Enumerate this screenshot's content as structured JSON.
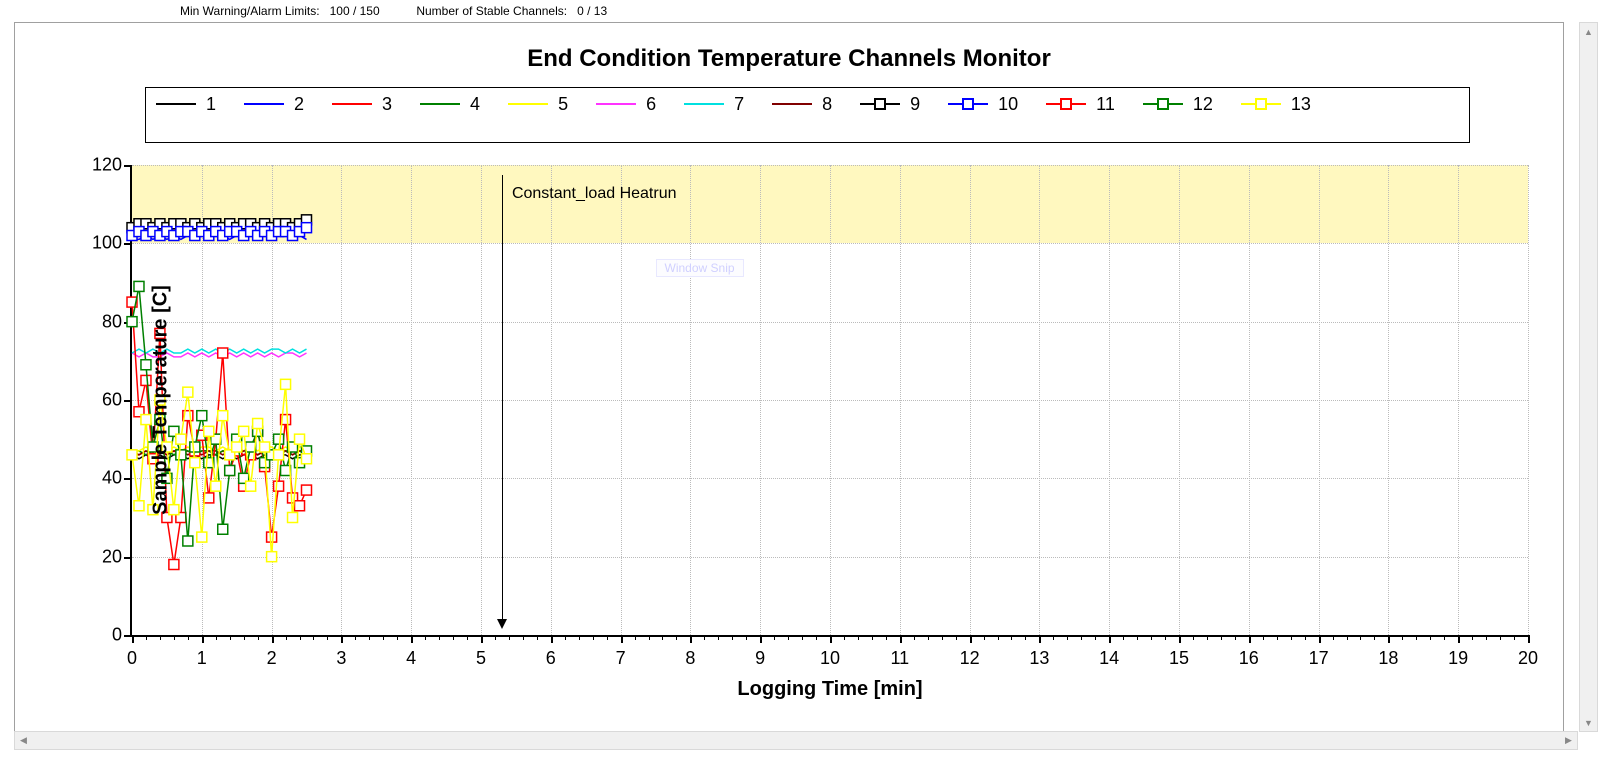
{
  "header": {
    "limits_label": "Min Warning/Alarm Limits:",
    "limits_value": "100 / 150",
    "stable_label": "Number of Stable Channels:",
    "stable_value": "0 / 13"
  },
  "chart_data": {
    "type": "line",
    "title": "End Condition Temperature Channels Monitor",
    "xlabel": "Logging Time [min]",
    "ylabel": "Sample Temperature [C]",
    "xlim": [
      0,
      20
    ],
    "ylim": [
      0,
      120
    ],
    "x_major_step": 1,
    "y_major_step": 20,
    "warning_band": {
      "low": 100,
      "high": 120,
      "low_label": "100",
      "high_label": "150"
    },
    "annotation": {
      "x": 5.3,
      "text": "Constant_load Heatrun"
    },
    "legend": [
      {
        "id": "1",
        "color": "#000000",
        "marker": false
      },
      {
        "id": "2",
        "color": "#0000ff",
        "marker": false
      },
      {
        "id": "3",
        "color": "#ff0000",
        "marker": false
      },
      {
        "id": "4",
        "color": "#008000",
        "marker": false
      },
      {
        "id": "5",
        "color": "#ffff00",
        "marker": false
      },
      {
        "id": "6",
        "color": "#ff33ff",
        "marker": false
      },
      {
        "id": "7",
        "color": "#00e0e0",
        "marker": false
      },
      {
        "id": "8",
        "color": "#800000",
        "marker": false
      },
      {
        "id": "9",
        "color": "#000000",
        "marker": true
      },
      {
        "id": "10",
        "color": "#0000ff",
        "marker": true
      },
      {
        "id": "11",
        "color": "#ff0000",
        "marker": true
      },
      {
        "id": "12",
        "color": "#008000",
        "marker": true
      },
      {
        "id": "13",
        "color": "#ffff00",
        "marker": true
      }
    ],
    "x": [
      0,
      0.1,
      0.2,
      0.3,
      0.4,
      0.5,
      0.6,
      0.7,
      0.8,
      0.9,
      1.0,
      1.1,
      1.2,
      1.3,
      1.4,
      1.5,
      1.6,
      1.7,
      1.8,
      1.9,
      2.0,
      2.1,
      2.2,
      2.3,
      2.4,
      2.5
    ],
    "series": [
      {
        "name": "1",
        "color": "#000000",
        "marker": false,
        "values": [
          46,
          45,
          46,
          45,
          46,
          45,
          46,
          46,
          45,
          46,
          45,
          46,
          46,
          45,
          46,
          45,
          46,
          46,
          45,
          46,
          45,
          46,
          46,
          45,
          46,
          46
        ]
      },
      {
        "name": "2",
        "color": "#0000ff",
        "marker": false,
        "values": [
          101,
          101,
          102,
          101,
          102,
          101,
          102,
          101,
          102,
          101,
          102,
          101,
          102,
          102,
          101,
          102,
          101,
          102,
          101,
          102,
          101,
          102,
          102,
          101,
          102,
          101
        ]
      },
      {
        "name": "3",
        "color": "#ff0000",
        "marker": false,
        "values": [
          46,
          46,
          47,
          46,
          47,
          46,
          47,
          46,
          47,
          46,
          47,
          47,
          46,
          47,
          46,
          47,
          46,
          47,
          46,
          47,
          47,
          46,
          47,
          46,
          47,
          47
        ]
      },
      {
        "name": "4",
        "color": "#008000",
        "marker": false,
        "values": [
          47,
          47,
          46,
          47,
          47,
          47,
          46,
          47,
          47,
          46,
          47,
          47,
          46,
          47,
          47,
          46,
          47,
          47,
          46,
          47,
          47,
          46,
          47,
          47,
          47,
          46
        ]
      },
      {
        "name": "5",
        "color": "#ffff00",
        "marker": false,
        "values": [
          47,
          47,
          48,
          47,
          48,
          47,
          48,
          47,
          48,
          47,
          48,
          48,
          47,
          48,
          47,
          48,
          47,
          48,
          47,
          48,
          48,
          47,
          48,
          47,
          48,
          48
        ]
      },
      {
        "name": "6",
        "color": "#ff33ff",
        "marker": false,
        "values": [
          72,
          71,
          72,
          71,
          71,
          72,
          71,
          71,
          72,
          71,
          72,
          71,
          72,
          71,
          72,
          71,
          72,
          71,
          72,
          71,
          72,
          71,
          72,
          72,
          71,
          72
        ]
      },
      {
        "name": "7",
        "color": "#00e0e0",
        "marker": false,
        "values": [
          72,
          73,
          72,
          73,
          72,
          73,
          72,
          72,
          73,
          72,
          73,
          72,
          73,
          72,
          73,
          72,
          73,
          72,
          73,
          72,
          73,
          73,
          72,
          73,
          72,
          73
        ]
      },
      {
        "name": "8",
        "color": "#800000",
        "marker": false,
        "values": [
          47,
          46,
          47,
          46,
          47,
          46,
          47,
          47,
          46,
          47,
          46,
          47,
          47,
          46,
          47,
          46,
          47,
          47,
          46,
          47,
          46,
          47,
          47,
          46,
          47,
          47
        ]
      },
      {
        "name": "9",
        "color": "#000000",
        "marker": true,
        "values": [
          104,
          105,
          105,
          104,
          105,
          104,
          105,
          105,
          104,
          105,
          104,
          105,
          105,
          104,
          105,
          104,
          105,
          105,
          104,
          105,
          104,
          105,
          105,
          104,
          105,
          106
        ]
      },
      {
        "name": "10",
        "color": "#0000ff",
        "marker": true,
        "values": [
          102,
          103,
          102,
          103,
          102,
          103,
          102,
          103,
          103,
          102,
          103,
          102,
          103,
          102,
          103,
          103,
          102,
          103,
          102,
          103,
          102,
          103,
          103,
          102,
          103,
          104
        ]
      },
      {
        "name": "11",
        "color": "#ff0000",
        "marker": true,
        "values": [
          85,
          57,
          65,
          45,
          77,
          30,
          18,
          30,
          56,
          47,
          51,
          35,
          50,
          72,
          42,
          47,
          38,
          46,
          52,
          43,
          25,
          38,
          55,
          35,
          33,
          37
        ]
      },
      {
        "name": "12",
        "color": "#008000",
        "marker": true,
        "values": [
          80,
          89,
          69,
          48,
          55,
          40,
          52,
          46,
          24,
          48,
          56,
          44,
          50,
          27,
          42,
          50,
          40,
          48,
          52,
          44,
          46,
          50,
          42,
          48,
          44,
          47
        ]
      },
      {
        "name": "13",
        "color": "#ffff00",
        "marker": true,
        "values": [
          46,
          33,
          55,
          32,
          60,
          48,
          32,
          50,
          62,
          44,
          25,
          52,
          38,
          56,
          46,
          48,
          52,
          38,
          54,
          48,
          20,
          46,
          64,
          30,
          50,
          45
        ]
      }
    ]
  },
  "floating_label": "Window Snip"
}
